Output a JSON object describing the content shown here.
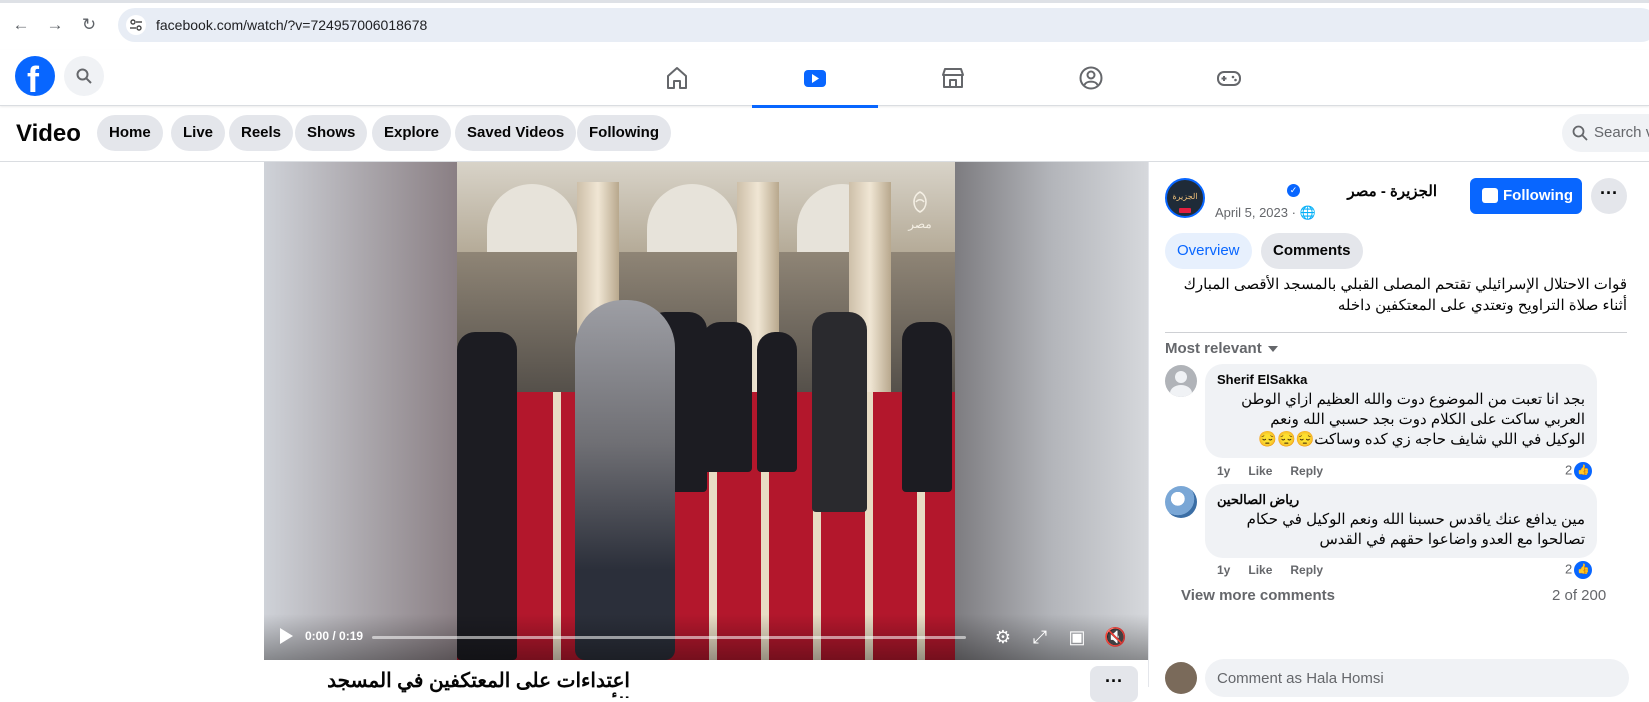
{
  "browser": {
    "url": "facebook.com/watch/?v=724957006018678"
  },
  "fb_nav": {
    "items": [
      {
        "name": "home-icon",
        "active": false
      },
      {
        "name": "watch-icon",
        "active": true
      },
      {
        "name": "marketplace-icon",
        "active": false
      },
      {
        "name": "groups-icon",
        "active": false
      },
      {
        "name": "gaming-icon",
        "active": false
      }
    ]
  },
  "watch_header": {
    "title": "Video",
    "pills": [
      "Home",
      "Live",
      "Reels",
      "Shows",
      "Explore",
      "Saved Videos",
      "Following"
    ],
    "search_placeholder": "Search v"
  },
  "player": {
    "time": "0:00 / 0:19",
    "watermark": "مصر",
    "progress": 0
  },
  "video": {
    "title": "اعتداءات على المعتكفين في المسجد الأقصى"
  },
  "channel": {
    "name": "الجزيرة - مصر",
    "verified": true,
    "date": "April 5, 2023 · ",
    "follow_label": "Following",
    "avatar_text": "الجزيرة"
  },
  "tabs": {
    "overview": "Overview",
    "comments": "Comments"
  },
  "description": "قوات الاحتلال الإسرائيلي تقتحم المصلى القبلي بالمسجد الأقصى المبارك أثناء صلاة التراويح وتعتدي على المعتكفين داخله",
  "comments": {
    "sort_label": "Most relevant",
    "items": [
      {
        "author": "Sherif ElSakka",
        "text": "بجد انا تعبت من الموضوع دوت والله العظيم ازاي الوطن العربي ساكت على الكلام دوت بجد حسبي الله ونعم الوكيل في اللي شايف حاجه زي كده وساكت😔😔😔",
        "age": "1y",
        "like": "Like",
        "reply": "Reply",
        "reactions": "2"
      },
      {
        "author": "رياض الصالحين",
        "text": "مين يدافع عنك ياقدس حسبنا الله ونعم الوكيل في حكام تصالحوا مع العدو واضاعوا حقهم في القدس",
        "age": "1y",
        "like": "Like",
        "reply": "Reply",
        "reactions": "2"
      }
    ],
    "view_more": "View more comments",
    "count": "2 of 200",
    "input_placeholder": "Comment as Hala Homsi"
  },
  "colors": {
    "brand": "#0866ff",
    "surface": "#f0f2f5",
    "secondary_text": "#65676b"
  }
}
